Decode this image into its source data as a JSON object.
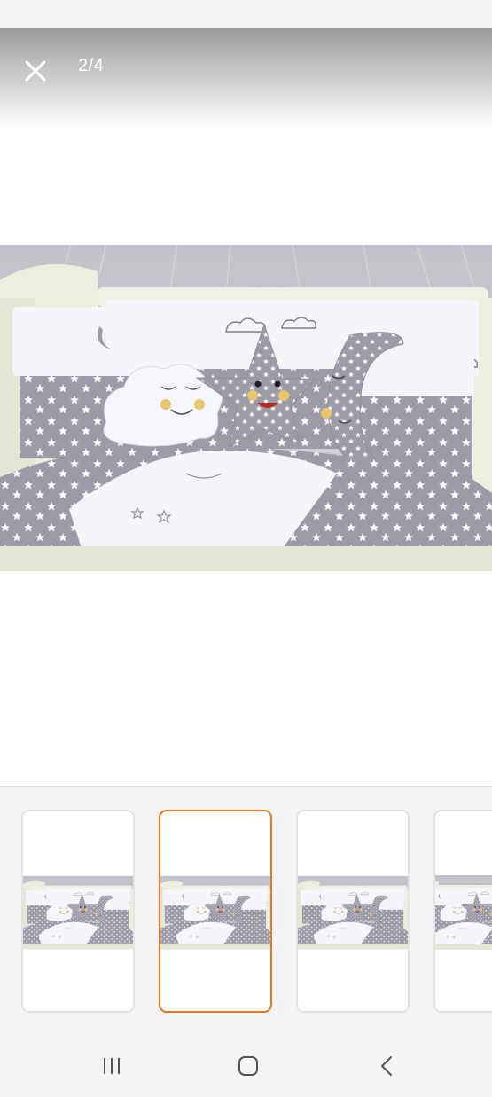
{
  "viewer": {
    "counter": "2/4",
    "close_icon": "close-icon"
  },
  "main_image": {
    "subject": "crib-bedding-photo",
    "colors": {
      "fabric_gray": "#9b9ca8",
      "fabric_white": "#f4f5f9",
      "crib_frame": "#eeeee0",
      "canopy": "#c9cad0"
    }
  },
  "thumbnails": [
    {
      "index": 1,
      "selected": false
    },
    {
      "index": 2,
      "selected": true
    },
    {
      "index": 3,
      "selected": false
    },
    {
      "index": 4,
      "selected": false
    }
  ],
  "colors": {
    "accent": "#e87722",
    "strip_bg": "#f4f4f4",
    "thumb_border": "#e3e3e3"
  },
  "nav": {
    "recents_icon": "recent-apps-icon",
    "home_icon": "home-icon",
    "back_icon": "back-icon"
  }
}
